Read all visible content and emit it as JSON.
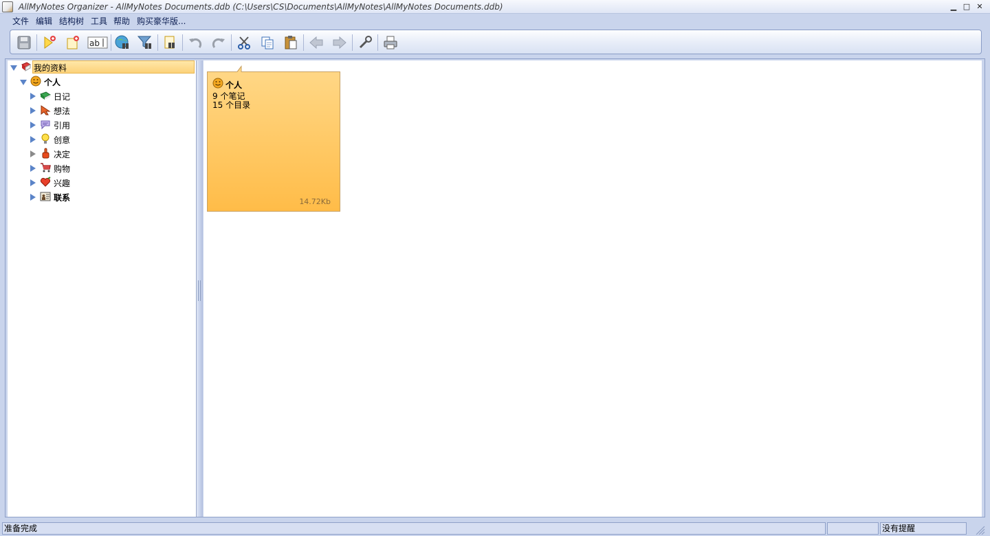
{
  "window": {
    "title": "AllMyNotes Organizer - AllMyNotes Documents.ddb (C:\\Users\\CS\\Documents\\AllMyNotes\\AllMyNotes Documents.ddb)",
    "minimize": "▁",
    "maximize": "□",
    "close": "✕"
  },
  "menu": [
    "文件",
    "编辑",
    "结构树",
    "工具",
    "帮助",
    "购买豪华版..."
  ],
  "toolbar": {
    "buttons": [
      "save-icon",
      "new-note-icon",
      "new-folder-icon",
      "rename-icon",
      "web-search-icon",
      "filter-icon",
      "find-icon",
      "undo-icon",
      "redo-icon",
      "cut-icon",
      "copy-icon",
      "paste-icon",
      "back-arrow-icon",
      "forward-arrow-icon",
      "tools-icon",
      "print-icon"
    ]
  },
  "tree": {
    "root": "我的资料",
    "child": "个人",
    "items": [
      "日记",
      "想法",
      "引用",
      "创意",
      "决定",
      "购物",
      "兴趣",
      "联系"
    ]
  },
  "card": {
    "title": "个人",
    "notes": "9 个笔记",
    "dirs": "15 个目录",
    "size": "14.72Kb"
  },
  "status": {
    "left": "准备完成",
    "right": "没有提醒"
  }
}
